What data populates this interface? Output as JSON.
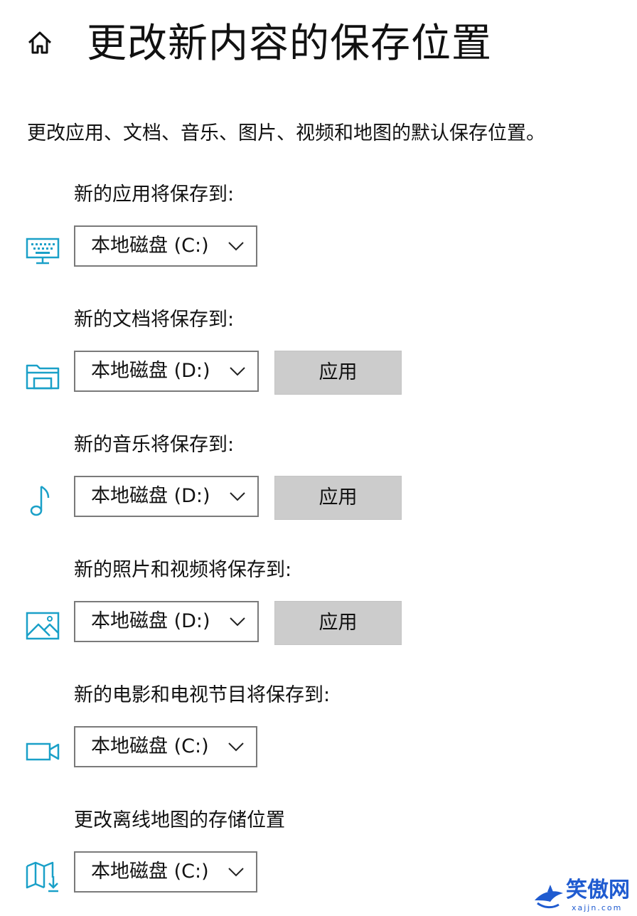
{
  "header": {
    "title": "更改新内容的保存位置",
    "home_icon": "home-icon"
  },
  "description": "更改应用、文档、音乐、图片、视频和地图的默认保存位置。",
  "accent_color": "#1aa0c8",
  "sections": [
    {
      "label": "新的应用将保存到:",
      "icon": "monitor-icon",
      "selected": "本地磁盘 (C:)"
    },
    {
      "label": "新的文档将保存到:",
      "icon": "folder-icon",
      "selected": "本地磁盘 (D:)",
      "apply_label": "应用"
    },
    {
      "label": "新的音乐将保存到:",
      "icon": "music-note-icon",
      "selected": "本地磁盘 (D:)",
      "apply_label": "应用"
    },
    {
      "label": "新的照片和视频将保存到:",
      "icon": "picture-icon",
      "selected": "本地磁盘 (D:)",
      "apply_label": "应用"
    },
    {
      "label": "新的电影和电视节目将保存到:",
      "icon": "video-camera-icon",
      "selected": "本地磁盘 (C:)"
    },
    {
      "label": "更改离线地图的存储位置",
      "icon": "map-download-icon",
      "selected": "本地磁盘 (C:)"
    }
  ],
  "watermark": {
    "text": "笑傲网",
    "sub": "xajjn.com"
  }
}
